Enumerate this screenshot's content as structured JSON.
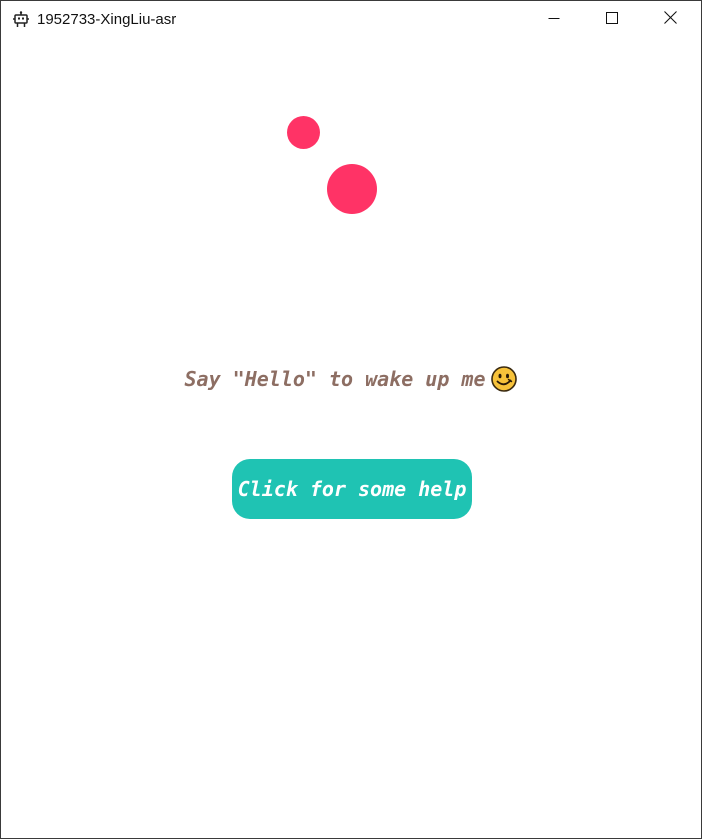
{
  "window": {
    "title": "1952733-XingLiu-asr",
    "icon": "robot-icon",
    "controls": {
      "minimize_icon": "minimize-icon",
      "maximize_icon": "maximize-icon",
      "close_icon": "close-icon"
    }
  },
  "main": {
    "prompt_text": "Say \"Hello\" to wake up me",
    "prompt_emoji": "smiley-face-icon",
    "help_button_label": "Click for some help"
  },
  "colors": {
    "dot": "#ff3366",
    "prompt_text": "#8d6e63",
    "button_bg": "#1fc3b3",
    "button_text": "#ffffff"
  }
}
